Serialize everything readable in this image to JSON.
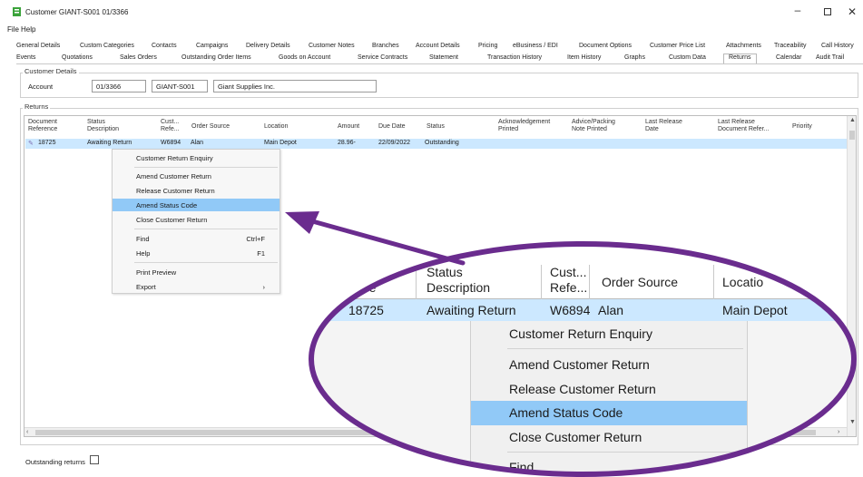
{
  "window": {
    "title": "Customer GIANT-S001 01/3366",
    "controls": {
      "minimize": "–",
      "close": "✕"
    }
  },
  "menu": [
    "File",
    "Help"
  ],
  "tabs_row1": [
    "General Details",
    "Custom Categories",
    "Contacts",
    "Campaigns",
    "Delivery Details",
    "Customer Notes",
    "Branches",
    "Account Details",
    "Pricing",
    "eBusiness / EDI",
    "Document Options",
    "Customer Price List",
    "Attachments",
    "Traceability",
    "Call History"
  ],
  "tabs_row2": [
    "Events",
    "Quotations",
    "Sales Orders",
    "Outstanding Order Items",
    "Goods on Account",
    "Service Contracts",
    "Statement",
    "Transaction History",
    "Item History",
    "Graphs",
    "Custom Data",
    "Returns",
    "Calendar",
    "Audit Trail"
  ],
  "active_tab": "Returns",
  "customer_details": {
    "group_label": "Customer Details",
    "account_label": "Account",
    "account_number": "01/3366",
    "account_code": "GIANT-S001",
    "account_name": "Giant Supplies Inc."
  },
  "returns": {
    "group_label": "Returns",
    "columns": [
      [
        "Document",
        "Reference"
      ],
      [
        "Status",
        "Description"
      ],
      [
        "Cust...",
        "Refe..."
      ],
      [
        "Order Source"
      ],
      [
        "Location"
      ],
      [
        "Amount"
      ],
      [
        "Due Date"
      ],
      [
        "Status"
      ],
      [
        "Acknowledgement",
        "Printed"
      ],
      [
        "Advice/Packing",
        "Note Printed"
      ],
      [
        "Last Release",
        "Date"
      ],
      [
        "Last Release",
        "Document Refer..."
      ],
      [
        "Priority"
      ]
    ],
    "rows": [
      {
        "document_reference": "18725",
        "status_description": "Awaiting Return",
        "customer_reference": "W6894",
        "order_source": "Alan",
        "location": "Main Depot",
        "amount": "28.96-",
        "due_date": "22/09/2022",
        "status": "Outstanding"
      }
    ]
  },
  "context_menu": {
    "items": [
      {
        "label": "Customer Return Enquiry",
        "shortcut": ""
      },
      {
        "label": "Amend Customer Return",
        "shortcut": ""
      },
      {
        "label": "Release Customer Return",
        "shortcut": ""
      },
      {
        "label": "Amend Status Code",
        "shortcut": "",
        "highlighted": true
      },
      {
        "label": "Close Customer Return",
        "shortcut": ""
      },
      {
        "label": "Find",
        "shortcut": "Ctrl+F"
      },
      {
        "label": "Help",
        "shortcut": "F1"
      },
      {
        "label": "Print Preview",
        "shortcut": ""
      },
      {
        "label": "Export",
        "shortcut": "›"
      }
    ]
  },
  "outstanding_returns_label": "Outstanding returns",
  "zoom": {
    "headers": [
      [
        "nt",
        "ence"
      ],
      [
        "Status",
        "Description"
      ],
      [
        "Cust...",
        "Refe..."
      ],
      [
        "Order Source"
      ],
      [
        "Locatio"
      ]
    ],
    "row": {
      "reference": "18725",
      "status_description": "Awaiting Return",
      "customer_reference": "W6894",
      "order_source": "Alan",
      "location": "Main Depot"
    },
    "menu_items": [
      "Customer Return Enquiry",
      "Amend Customer Return",
      "Release Customer Return",
      "Amend Status Code",
      "Close Customer Return",
      "Find"
    ]
  },
  "colors": {
    "selection": "#cce8ff",
    "menu_highlight": "#91c9f7",
    "annotation_purple": "#6a2c8e"
  }
}
